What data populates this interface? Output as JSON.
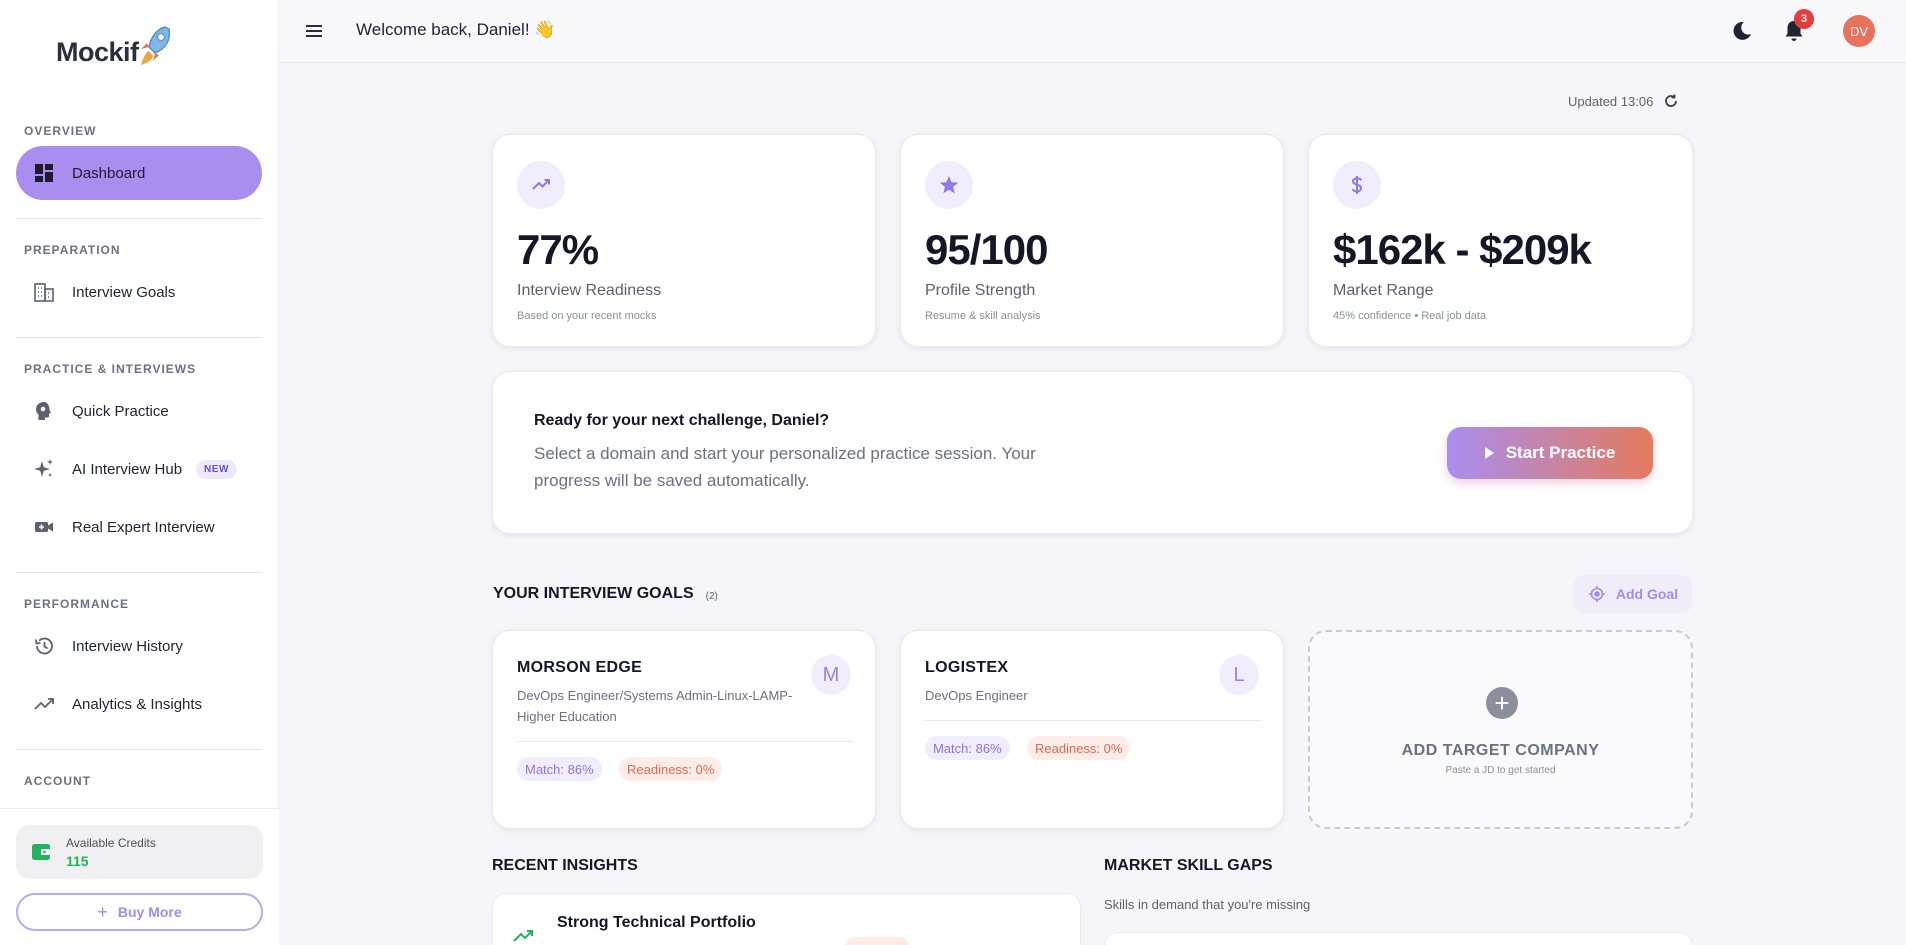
{
  "app": {
    "name": "Mockif"
  },
  "header": {
    "welcome": "Welcome back, Daniel! 👋",
    "notification_count": "3",
    "avatar_initials": "DV"
  },
  "sidebar": {
    "sections": [
      {
        "title": "OVERVIEW",
        "items": [
          {
            "label": "Dashboard",
            "icon": "dashboard-icon",
            "active": true
          }
        ]
      },
      {
        "title": "PREPARATION",
        "items": [
          {
            "label": "Interview Goals",
            "icon": "building-icon"
          }
        ]
      },
      {
        "title": "PRACTICE & INTERVIEWS",
        "items": [
          {
            "label": "Quick Practice",
            "icon": "brain-head-icon"
          },
          {
            "label": "AI Interview Hub",
            "icon": "sparkle-icon",
            "badge": "NEW"
          },
          {
            "label": "Real Expert Interview",
            "icon": "video-call-icon"
          }
        ]
      },
      {
        "title": "PERFORMANCE",
        "items": [
          {
            "label": "Interview History",
            "icon": "history-icon"
          },
          {
            "label": "Analytics & Insights",
            "icon": "trend-icon"
          }
        ]
      },
      {
        "title": "ACCOUNT",
        "items": []
      }
    ],
    "credits": {
      "label": "Available Credits",
      "value": "115"
    },
    "buy_more_label": "Buy More"
  },
  "main": {
    "updated": "Updated 13:06",
    "stats": [
      {
        "value": "77%",
        "label": "Interview Readiness",
        "sub": "Based on your recent mocks",
        "icon": "trending-up-icon"
      },
      {
        "value": "95/100",
        "label": "Profile Strength",
        "sub": "Resume & skill analysis",
        "icon": "star-icon"
      },
      {
        "value": "$162k - $209k",
        "label": "Market Range",
        "sub": "45% confidence • Real job data",
        "icon": "dollar-icon"
      }
    ],
    "challenge": {
      "title": "Ready for your next challenge, Daniel?",
      "desc": "Select a domain and start your personalized practice session. Your progress will be saved automatically.",
      "button": "Start Practice"
    },
    "goals": {
      "title": "YOUR INTERVIEW GOALS",
      "count": "(2)",
      "add_label": "Add Goal",
      "items": [
        {
          "company": "MORSON EDGE",
          "role": "DevOps Engineer/Systems Admin-Linux-LAMP-Higher Education",
          "letter": "M",
          "match": "Match: 86%",
          "readiness": "Readiness: 0%"
        },
        {
          "company": "LOGISTEX",
          "role": "DevOps Engineer",
          "letter": "L",
          "match": "Match: 86%",
          "readiness": "Readiness: 0%"
        }
      ],
      "add_company": {
        "title": "ADD TARGET COMPANY",
        "sub": "Paste a JD to get started"
      }
    },
    "insights": {
      "title": "RECENT INSIGHTS",
      "first_item": "Strong Technical Portfolio"
    },
    "skill_gaps": {
      "title": "MARKET SKILL GAPS",
      "sub": "Skills in demand that you're missing"
    }
  },
  "colors": {
    "accent": "#a98ef0",
    "accent_end": "#e57a5e",
    "success": "#22b35e",
    "danger": "#e53d3d"
  }
}
